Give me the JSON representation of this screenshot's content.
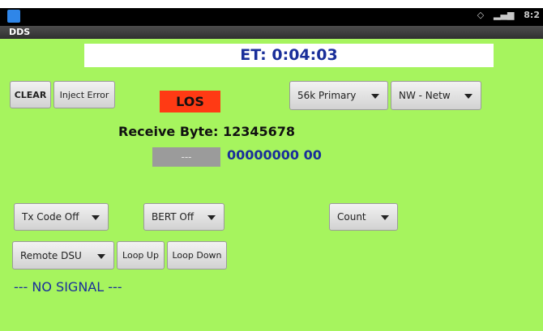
{
  "status_bar": {
    "app_icon": "app-notification-icon",
    "icons": [
      "sync-icon",
      "signal-strength-icon"
    ],
    "time": "8:2"
  },
  "title_bar": {
    "title": "DDS"
  },
  "elapsed": {
    "text": "ET: 0:04:03"
  },
  "toolbar": {
    "clear_label": "CLEAR",
    "inject_error_label": "Inject Error",
    "los_label": "LOS",
    "rate_select": "56k Primary",
    "network_select": "NW - Netw"
  },
  "receive": {
    "label": "Receive Byte: 12345678",
    "field_value": "---",
    "bits": "00000000 00"
  },
  "controls": {
    "tx_code_select": "Tx Code Off",
    "bert_select": "BERT Off",
    "count_select": "Count",
    "remote_select": "Remote DSU",
    "loop_up_label": "Loop Up",
    "loop_down_label": "Loop Down"
  },
  "signal_status": "--- NO SIGNAL ---",
  "colors": {
    "background": "#a6f45e",
    "alarm": "#ff3a14",
    "text_blue": "#1a2f9a"
  }
}
